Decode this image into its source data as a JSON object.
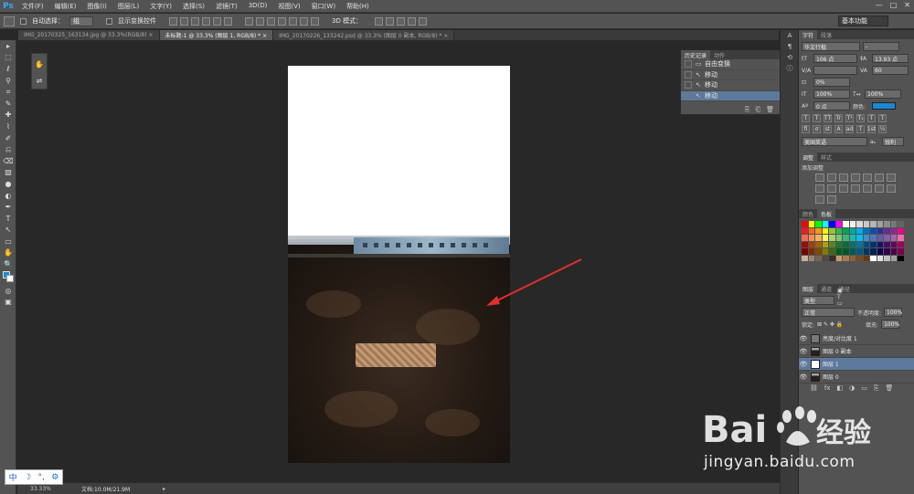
{
  "app": {
    "logo": "Ps"
  },
  "menu": [
    "文件(F)",
    "编辑(E)",
    "图像(I)",
    "图层(L)",
    "文字(Y)",
    "选择(S)",
    "滤镜(T)",
    "3D(D)",
    "视图(V)",
    "窗口(W)",
    "帮助(H)"
  ],
  "window_controls": [
    "—",
    "□",
    "✕"
  ],
  "options": {
    "auto_select_label": "自动选择：",
    "auto_select_value": "组",
    "show_transform_label": "显示变换控件",
    "mode_3d_label": "3D 模式：",
    "workspace": "基本功能"
  },
  "tabs": [
    {
      "label": "IMG_20170325_163134.jpg @ 33.3%(RGB/8) ×",
      "active": false
    },
    {
      "label": "未标题-1 @ 33.3% (图层 1, RGB/8) * ×",
      "active": true
    },
    {
      "label": "IMG_20170226_133242.psd @ 33.3% (图层 0 副本, RGB/8) * ×",
      "active": false
    }
  ],
  "tools": [
    "▸",
    "⬚",
    "ℓ",
    "⚲",
    "⌗",
    "✎",
    "✚",
    "⌇",
    "✐",
    "⎌",
    "⌫",
    "▧",
    "●",
    "◐",
    "✒",
    "T",
    "↖",
    "▭",
    "✋",
    "🔍"
  ],
  "status": {
    "zoom": "33.33%",
    "doc_size": "文档:10.0M/21.9M",
    "arrow": "▸"
  },
  "ime": [
    "中",
    "☽",
    "°,",
    "⚙"
  ],
  "history": {
    "tabs": [
      "历史记录",
      "动作"
    ],
    "rows": [
      {
        "icon": "▭",
        "label": "自由变换",
        "selected": false
      },
      {
        "icon": "↖",
        "label": "移动",
        "selected": false
      },
      {
        "icon": "↖",
        "label": "移动",
        "selected": false
      },
      {
        "icon": "↖",
        "label": "移动",
        "selected": true
      }
    ],
    "footer_icons": [
      "⎘",
      "⎗",
      "🗑"
    ]
  },
  "character": {
    "tabs": [
      "字符",
      "段落"
    ],
    "font_family": "华文行楷",
    "font_style": "-",
    "size": "106 点",
    "leading": "13.93 点",
    "tracking_label": "V/A",
    "tracking": "60",
    "scale_pct": "0%",
    "vscale": "100%",
    "hscale": "100%",
    "baseline": "0 点",
    "color_label": "颜色:",
    "text_color": "#1a88d4",
    "style_buttons": [
      "T",
      "T",
      "TT",
      "Tr",
      "T¹",
      "T₁",
      "T",
      "T"
    ],
    "extra_buttons": [
      "fi",
      "ơ",
      "st",
      "A",
      "ad",
      "T",
      "1st",
      "½"
    ],
    "language": "美国英语",
    "antialias_prefix": "aₐ",
    "antialias": "锐利"
  },
  "adjustments": {
    "tabs": [
      "调整",
      "样式"
    ],
    "title": "添加调整"
  },
  "swatches_panel": {
    "tabs": [
      "颜色",
      "色板"
    ],
    "colors": [
      "#ff0000",
      "#ffff00",
      "#00ff00",
      "#00ffff",
      "#0000ff",
      "#ff00ff",
      "#ffffff",
      "#f0f0f0",
      "#dcdcdc",
      "#c8c8c8",
      "#b4b4b4",
      "#a0a0a0",
      "#8c8c8c",
      "#787878",
      "#646464",
      "#ed1c24",
      "#f26522",
      "#f7941d",
      "#fff200",
      "#8dc63f",
      "#39b54a",
      "#00a651",
      "#00a99d",
      "#00aeef",
      "#0072bc",
      "#0054a6",
      "#2e3192",
      "#662d91",
      "#92278f",
      "#ec008c",
      "#f26c4f",
      "#f68e55",
      "#fbaf5c",
      "#fff467",
      "#acd372",
      "#7cc576",
      "#3bb878",
      "#1abbb4",
      "#00bff3",
      "#438cca",
      "#5574b9",
      "#605ca8",
      "#855fa8",
      "#a763a8",
      "#f06eaa",
      "#9e0b0f",
      "#a0410d",
      "#a3620a",
      "#aba000",
      "#598527",
      "#197b30",
      "#007236",
      "#00746b",
      "#0076a3",
      "#004b80",
      "#003471",
      "#1b1464",
      "#440e62",
      "#630460",
      "#9e005d",
      "#790000",
      "#7b2e00",
      "#7d4900",
      "#827b00",
      "#406618",
      "#005e20",
      "#005826",
      "#005952",
      "#005b7f",
      "#003663",
      "#002157",
      "#0d004c",
      "#32004b",
      "#4b0049",
      "#7b0046",
      "#c7b299",
      "#998675",
      "#736357",
      "#534741",
      "#37302a",
      "#c69c6d",
      "#a67c52",
      "#8c6239",
      "#754c24",
      "#603913",
      "#ffffff",
      "#e0e0e0",
      "#c0c0c0",
      "#a0a0a0",
      "#000000"
    ]
  },
  "layers": {
    "tabs": [
      "图层",
      "通道",
      "路径"
    ],
    "filter": "类型",
    "blend": "正常",
    "opacity_label": "不透明度:",
    "opacity": "100%",
    "lock_label": "锁定:",
    "fill_label": "填充:",
    "fill": "100%",
    "rows": [
      {
        "name": "亮度/对比度 1",
        "thumb": "adj",
        "selected": false
      },
      {
        "name": "图层 0 副本",
        "thumb": "photo",
        "selected": false
      },
      {
        "name": "图层 1",
        "thumb": "white",
        "selected": true
      },
      {
        "name": "图层 0",
        "thumb": "photo",
        "selected": false
      }
    ],
    "footer_icons": [
      "⛓",
      "fx",
      "◧",
      "◑",
      "▭",
      "⎘",
      "🗑"
    ]
  },
  "watermark": {
    "text": "jingyan.baidu.com"
  }
}
